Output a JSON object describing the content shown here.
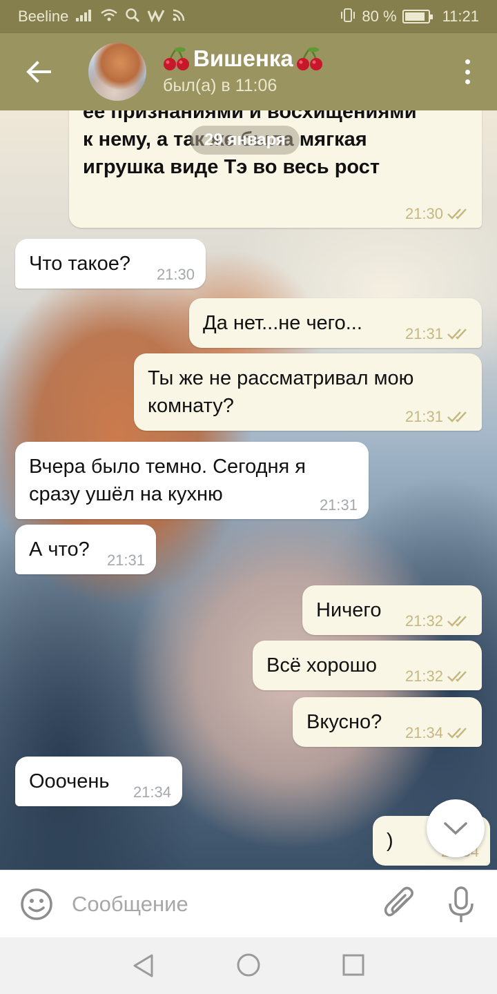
{
  "status_bar": {
    "carrier": "Beeline",
    "battery": "80 %",
    "battery_level": 0.8,
    "time": "11:21"
  },
  "header": {
    "name": "Вишенка",
    "name_emoji": "cherries-icon",
    "last_seen": "был(а) в 11:06",
    "back_icon": "arrow-left-icon",
    "menu_icon": "more-vertical-icon"
  },
  "date_divider": "29 января",
  "messages": [
    {
      "dir": "out",
      "text": "Всё красивым подарком. Ещё с ещё признаниями и восхищениями к нему, а так же была мягкая игрушка виде Тэ во весь рост",
      "visible_lines": [
        "её признаниями и восхищениями",
        "к нему, а так же была мягкая",
        "игрушка виде Тэ во весь рост"
      ],
      "time": "21:30",
      "read": true
    },
    {
      "dir": "in",
      "text": "Что такое?",
      "time": "21:30"
    },
    {
      "dir": "out",
      "text": "Да нет...не чего...",
      "time": "21:31",
      "read": true
    },
    {
      "dir": "out",
      "text": "Ты же не рассматривал мою комнату?",
      "time": "21:31",
      "read": true
    },
    {
      "dir": "in",
      "text": "Вчера было темно. Сегодня я сразу ушёл на кухню",
      "time": "21:31"
    },
    {
      "dir": "in",
      "text": "А что?",
      "time": "21:31"
    },
    {
      "dir": "out",
      "text": "Ничего",
      "time": "21:32",
      "read": true
    },
    {
      "dir": "out",
      "text": "Всё хорошо",
      "time": "21:32",
      "read": true
    },
    {
      "dir": "out",
      "text": "Вкусно?",
      "time": "21:34",
      "read": true
    },
    {
      "dir": "in",
      "text": "Ооочень",
      "time": "21:34"
    },
    {
      "dir": "out",
      "text": ")",
      "time": "21:34",
      "read": true
    }
  ],
  "composer": {
    "placeholder": "Сообщение"
  },
  "colors": {
    "header": "#9a9560",
    "status_bar": "#857f4e",
    "bubble_out": "#f9f6e6",
    "bubble_in": "#ffffff",
    "check": "#c4b880"
  }
}
